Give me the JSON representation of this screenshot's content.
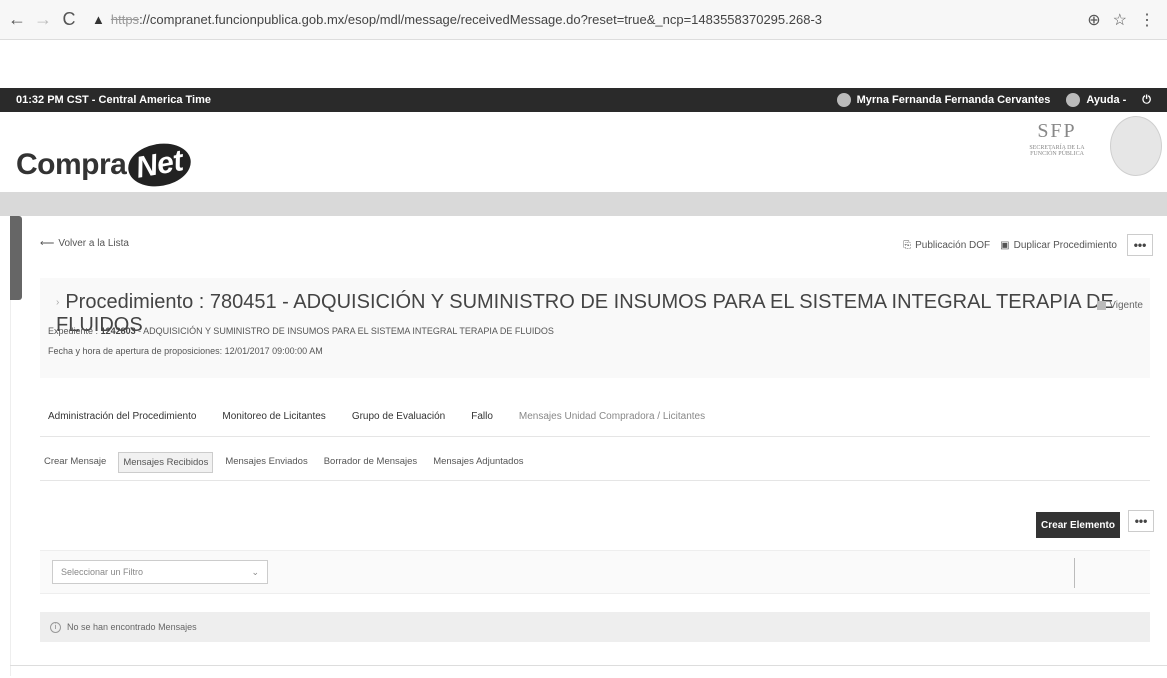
{
  "browser": {
    "back": "←",
    "forward": "→",
    "reload": "C",
    "warning": "▲",
    "url_proto": "https",
    "url_rest": "://compranet.funcionpublica.gob.mx/esop/mdl/message/receivedMessage.do?reset=true&_ncp=1483558370295.268-3",
    "zoom_icon": "⊕",
    "star_icon": "☆",
    "menu_icon": "⋮"
  },
  "topbar": {
    "time": "01:32 PM CST - Central America Time",
    "user": "Myrna Fernanda Fernanda Cervantes",
    "help": "Ayuda -",
    "power": "⏻"
  },
  "header": {
    "logo_compra": "Compra",
    "logo_net": "Net",
    "sfp": "SFP",
    "sfp_sub": "SECRETARÍA DE LA FUNCIÓN PÚBLICA"
  },
  "page": {
    "back_link": "Volver a la Lista",
    "publicacion": "Publicación DOF",
    "duplicar": "Duplicar Procedimiento",
    "dots": "•••",
    "procedure_title": "Procedimiento : 780451 - ADQUISICIÓN Y SUMINISTRO DE INSUMOS PARA EL SISTEMA INTEGRAL TERAPIA DE FLUIDOS",
    "status": "Vigente",
    "expediente_label": "Expediente :",
    "expediente_num": "1242803",
    "expediente_text": "- ADQUISICIÓN Y SUMINISTRO DE INSUMOS PARA EL SISTEMA INTEGRAL TERAPIA DE FLUIDOS",
    "fecha": "Fecha y hora de apertura de proposiciones: 12/01/2017 09:00:00 AM"
  },
  "tabs": [
    "Administración del Procedimiento",
    "Monitoreo de Licitantes",
    "Grupo de Evaluación",
    "Fallo",
    "Mensajes Unidad Compradora / Licitantes"
  ],
  "subtabs": [
    "Crear Mensaje",
    "Mensajes Recibidos",
    "Mensajes Enviados",
    "Borrador de Mensajes",
    "Mensajes Adjuntados"
  ],
  "actions": {
    "create": "Crear Elemento",
    "dots": "•••"
  },
  "filter": {
    "placeholder": "Seleccionar un Filtro",
    "arrow": "⌄"
  },
  "empty": {
    "icon": "i",
    "message": "No se han encontrado Mensajes"
  }
}
